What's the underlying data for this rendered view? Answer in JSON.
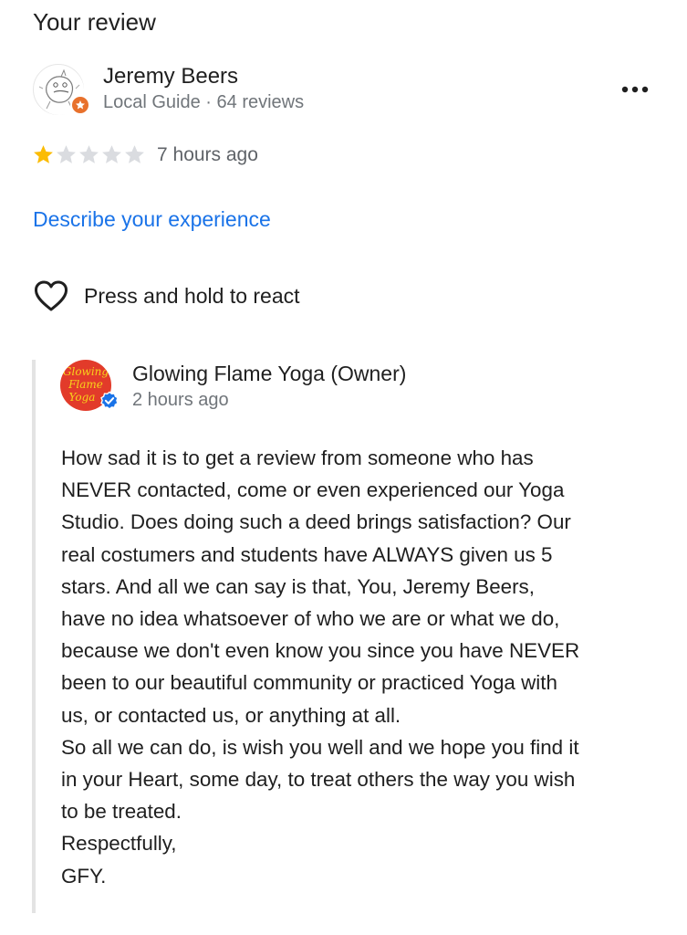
{
  "section": {
    "title": "Your review"
  },
  "reviewer": {
    "name": "Jeremy Beers",
    "meta": "Local Guide · 64 reviews",
    "badge_icon": "local-guide-star-icon",
    "badge_color": "#e8712c"
  },
  "menu": {
    "icon": "more-horizontal-icon"
  },
  "rating": {
    "value": 1,
    "max": 5,
    "filled_color": "#fbbc04",
    "empty_color": "#dadce0"
  },
  "review": {
    "time": "7 hours ago",
    "describe_link": "Describe your experience"
  },
  "reaction": {
    "icon": "heart-outline-icon",
    "label": "Press and hold to react"
  },
  "owner_reply": {
    "logo_text": [
      "Glowing",
      "Flame",
      "Yoga"
    ],
    "logo_color": "#e23b2a",
    "logo_text_color": "#f7d21b",
    "verified_icon": "verified-check-icon",
    "verified_color": "#1a73e8",
    "name": "Glowing Flame Yoga (Owner)",
    "time": "2 hours ago",
    "lines": [
      "How sad it is to get a review from someone who has",
      "NEVER contacted, come or even experienced our Yoga",
      "Studio. Does doing such a deed brings satisfaction? Our",
      "real costumers and students have ALWAYS given us 5",
      "stars. And all we can say is that, You, Jeremy Beers,",
      "have no idea whatsoever of who we are or what we do,",
      "because we don't even know you since you have NEVER",
      "been to our beautiful community or practiced Yoga with",
      "us, or contacted us, or anything at all.",
      "So all we can do, is wish you well and we hope you find it",
      "in your Heart, some day, to treat others the way you wish",
      "to be treated.",
      "Respectfully,",
      "GFY."
    ]
  }
}
